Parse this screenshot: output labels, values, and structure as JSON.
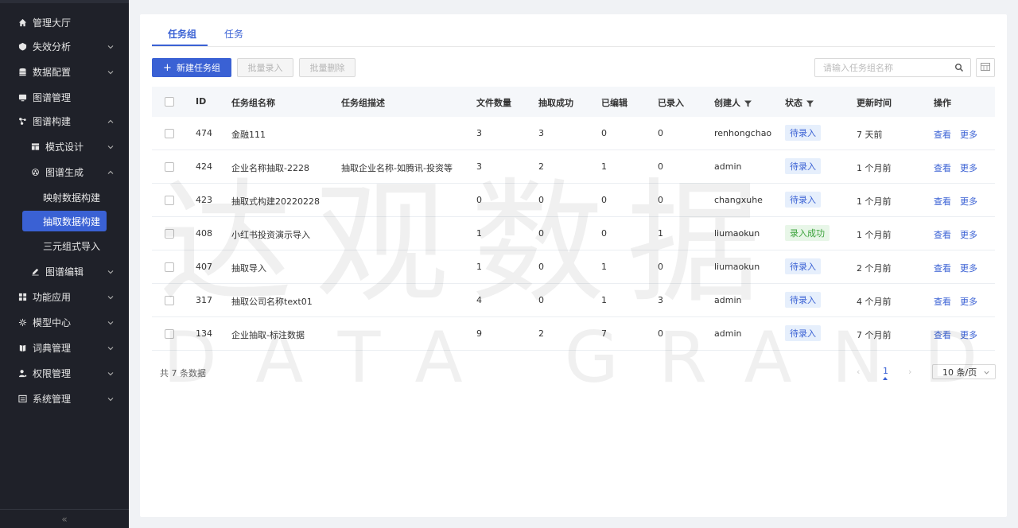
{
  "sidebar": {
    "items": [
      {
        "label": "管理大厅",
        "icon": "home-icon"
      },
      {
        "label": "失效分析",
        "icon": "shield-icon"
      },
      {
        "label": "数据配置",
        "icon": "database-icon"
      },
      {
        "label": "图谱管理",
        "icon": "monitor-icon"
      },
      {
        "label": "图谱构建",
        "icon": "graph-icon"
      },
      {
        "label": "模式设计",
        "icon": "layout-icon"
      },
      {
        "label": "图谱生成",
        "icon": "cluster-icon"
      },
      {
        "label": "映射数据构建"
      },
      {
        "label": "抽取数据构建"
      },
      {
        "label": "三元组式导入"
      },
      {
        "label": "图谱编辑",
        "icon": "edit-icon"
      },
      {
        "label": "功能应用",
        "icon": "apps-icon"
      },
      {
        "label": "模型中心",
        "icon": "model-icon"
      },
      {
        "label": "词典管理",
        "icon": "book-icon"
      },
      {
        "label": "权限管理",
        "icon": "user-icon"
      },
      {
        "label": "系统管理",
        "icon": "settings-icon"
      }
    ],
    "collapse_label": "«"
  },
  "tabs": [
    {
      "label": "任务组"
    },
    {
      "label": "任务"
    }
  ],
  "toolbar": {
    "new_label": "新建任务组",
    "new_plus": "+",
    "batch_import_label": "批量录入",
    "batch_delete_label": "批量删除",
    "search_placeholder": "请输入任务组名称"
  },
  "table": {
    "columns": [
      "ID",
      "任务组名称",
      "任务组描述",
      "文件数量",
      "抽取成功",
      "已编辑",
      "已录入",
      "创建人",
      "状态",
      "更新时间",
      "操作"
    ],
    "rows": [
      {
        "id": "474",
        "name": "金融111",
        "desc": "",
        "files": "3",
        "success": "3",
        "edited": "0",
        "recorded": "0",
        "creator": "renhongchao",
        "status": "待录入",
        "updated": "7 天前",
        "view": "查看",
        "more": "更多"
      },
      {
        "id": "424",
        "name": "企业名称抽取-2228",
        "desc": "抽取企业名称-如腾讯-投资等",
        "files": "3",
        "success": "2",
        "edited": "1",
        "recorded": "0",
        "creator": "admin",
        "status": "待录入",
        "updated": "1 个月前",
        "view": "查看",
        "more": "更多"
      },
      {
        "id": "423",
        "name": "抽取式构建20220228",
        "desc": "",
        "files": "0",
        "success": "0",
        "edited": "0",
        "recorded": "0",
        "creator": "changxuhe",
        "status": "待录入",
        "updated": "1 个月前",
        "view": "查看",
        "more": "更多"
      },
      {
        "id": "408",
        "name": "小红书投资演示导入",
        "desc": "",
        "files": "1",
        "success": "0",
        "edited": "0",
        "recorded": "1",
        "creator": "liumaokun",
        "status": "录入成功",
        "updated": "1 个月前",
        "view": "查看",
        "more": "更多"
      },
      {
        "id": "407",
        "name": "抽取导入",
        "desc": "",
        "files": "1",
        "success": "0",
        "edited": "1",
        "recorded": "0",
        "creator": "liumaokun",
        "status": "待录入",
        "updated": "2 个月前",
        "view": "查看",
        "more": "更多"
      },
      {
        "id": "317",
        "name": "抽取公司名称text01",
        "desc": "",
        "files": "4",
        "success": "0",
        "edited": "1",
        "recorded": "3",
        "creator": "admin",
        "status": "待录入",
        "updated": "4 个月前",
        "view": "查看",
        "more": "更多"
      },
      {
        "id": "134",
        "name": "企业抽取-标注数据",
        "desc": "",
        "files": "9",
        "success": "2",
        "edited": "7",
        "recorded": "0",
        "creator": "admin",
        "status": "待录入",
        "updated": "7 个月前",
        "view": "查看",
        "more": "更多"
      }
    ]
  },
  "pagination": {
    "total": "共 7 条数据",
    "prev": "‹",
    "next": "›",
    "current": "1",
    "page_size": "10 条/页"
  },
  "watermark": {
    "cn": "达观数据",
    "en": "DATA GRAND"
  },
  "colors": {
    "accent": "#3a61d4",
    "sidebar_bg": "#1f2129",
    "pending_badge_bg": "#e6effc",
    "pending_badge_text": "#3a61d4",
    "success_badge_bg": "#e8f6e8",
    "success_badge_text": "#3ca33c"
  }
}
